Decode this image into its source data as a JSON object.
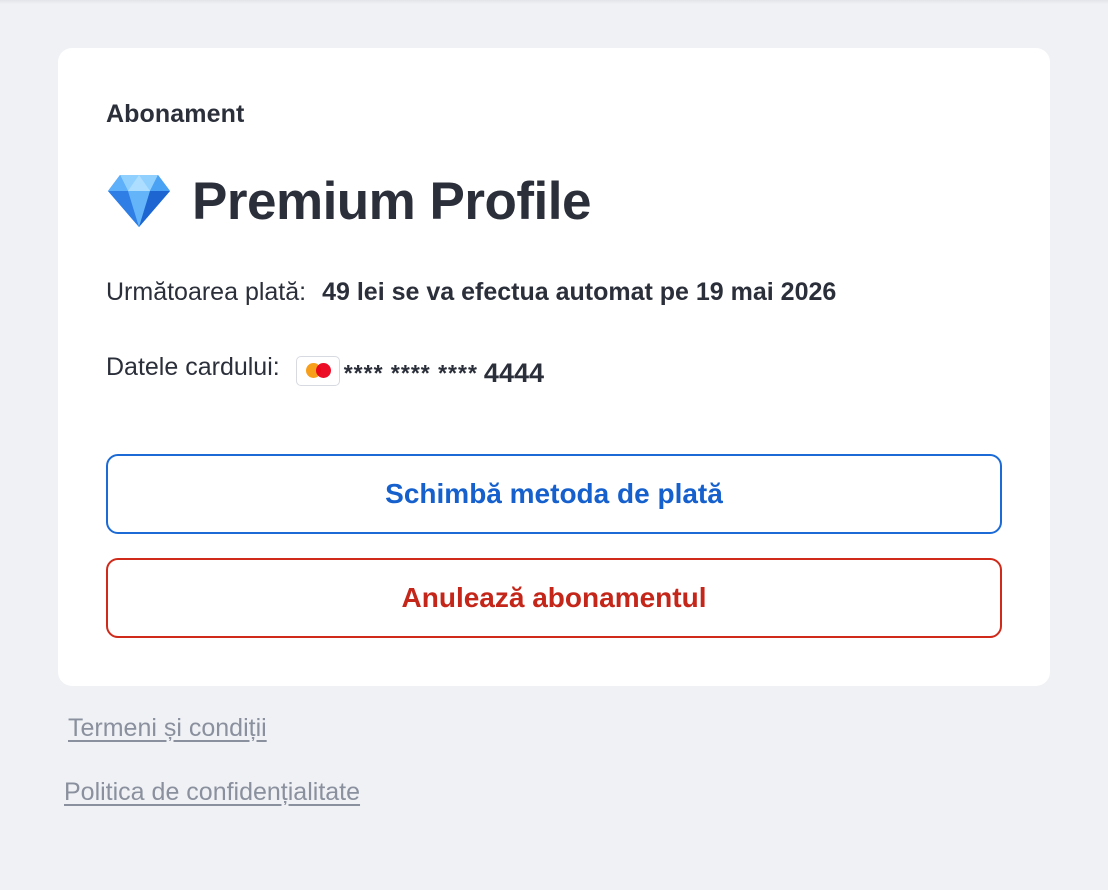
{
  "subscription": {
    "section_label": "Abonament",
    "plan_icon": "diamond-icon",
    "plan_name": "Premium Profile",
    "next_payment_label": "Următoarea plată:",
    "next_payment_value": "49 lei se va efectua automat pe 19 mai 2026",
    "card_label": "Datele cardului:",
    "card_brand_icon": "mastercard-icon",
    "card_masked": "**** **** ****",
    "card_last4": "4444"
  },
  "actions": {
    "change_payment_label": "Schimbă metoda de plată",
    "cancel_label": "Anulează abonamentul"
  },
  "footer": {
    "terms_label": "Termeni și condiții",
    "privacy_label": "Politica de confidențialitate"
  },
  "colors": {
    "page_background": "#eff1f5",
    "card_background": "#ffffff",
    "text_primary": "#2b2f3a",
    "accent_blue": "#1560cc",
    "danger_red": "#c5261a",
    "link_gray": "#8a909d"
  }
}
